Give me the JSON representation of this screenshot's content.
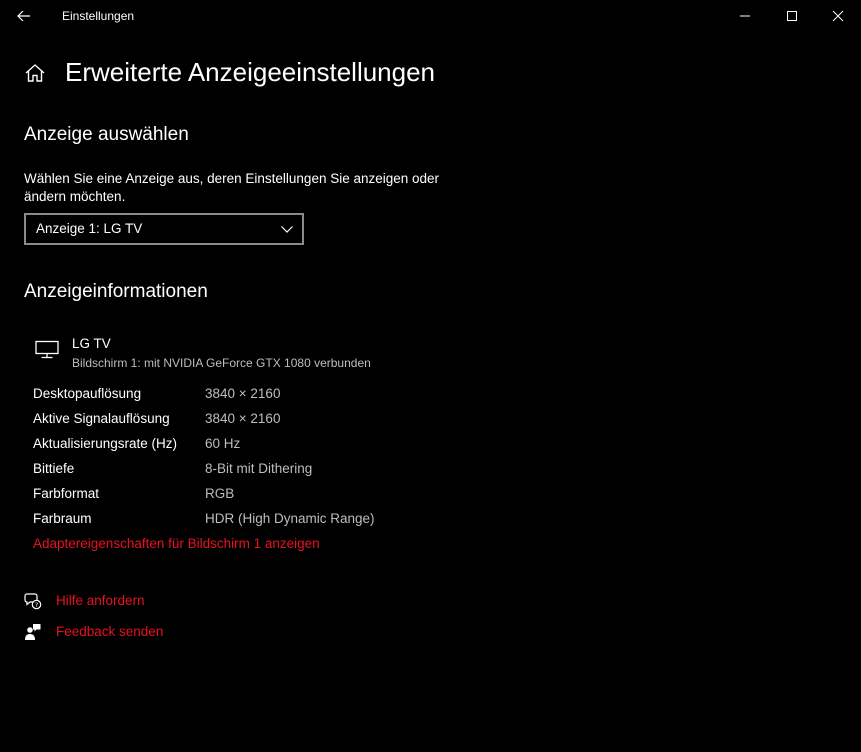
{
  "window": {
    "title": "Einstellungen",
    "back_icon": "arrow-left-icon",
    "controls": [
      "minimize-icon",
      "maximize-icon",
      "close-icon"
    ]
  },
  "header": {
    "home_icon": "home-icon",
    "title": "Erweiterte Anzeigeeinstellungen"
  },
  "select_display": {
    "heading": "Anzeige auswählen",
    "description": "Wählen Sie eine Anzeige aus, deren Einstellungen Sie anzeigen oder ändern möchten.",
    "dropdown_value": "Anzeige 1: LG TV"
  },
  "display_info": {
    "heading": "Anzeigeinformationen",
    "monitor_icon": "monitor-icon",
    "monitor_name": "LG TV",
    "monitor_subtitle": "Bildschirm 1: mit NVIDIA GeForce GTX 1080 verbunden",
    "rows": [
      {
        "label": "Desktopauflösung",
        "value": "3840 × 2160"
      },
      {
        "label": "Aktive Signalauflösung",
        "value": "3840 × 2160"
      },
      {
        "label": "Aktualisierungsrate (Hz)",
        "value": "60 Hz"
      },
      {
        "label": "Bittiefe",
        "value": "8-Bit mit Dithering"
      },
      {
        "label": "Farbformat",
        "value": "RGB"
      },
      {
        "label": "Farbraum",
        "value": "HDR (High Dynamic Range)"
      }
    ],
    "adapter_link": "Adaptereigenschaften für Bildschirm 1 anzeigen"
  },
  "help": {
    "get_help": "Hilfe anfordern",
    "get_help_icon": "chat-help-icon",
    "feedback": "Feedback senden",
    "feedback_icon": "feedback-icon"
  },
  "colors": {
    "background": "#000000",
    "accent_link": "#e81123",
    "secondary_text": "#bdbdbd"
  }
}
